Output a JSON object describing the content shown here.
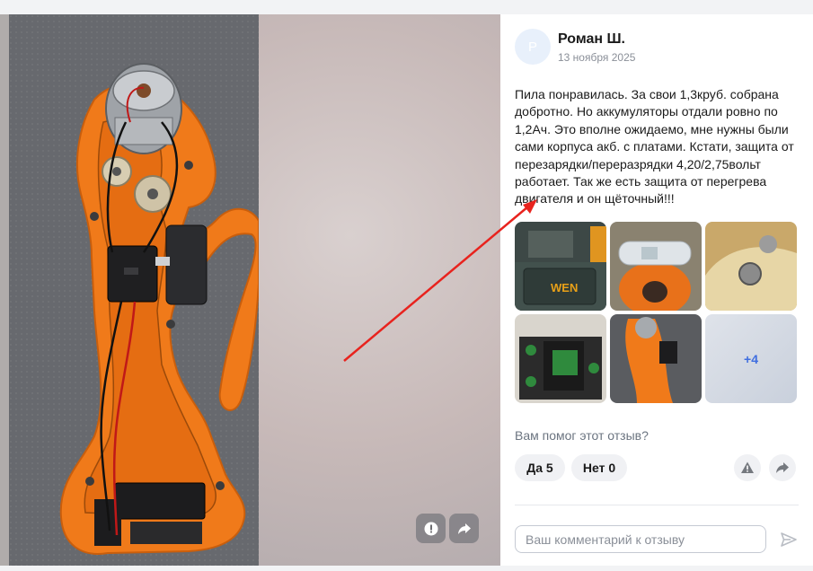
{
  "review": {
    "author_initial": "Р",
    "author": "Роман Ш.",
    "date": "13 ноября 2025",
    "text": "Пила понравилась. За свои 1,3круб. собрана добротно. Но аккумуляторы отдали ровно по 1,2Ач. Это вполне ожидаемо, мне нужны были сами корпуса акб. с платами. Кстати, защита от перезарядки/переразрядки 4,20/2,75вольт работает. Так же есть защита от перегрева двигателя и он щёточный!!!",
    "more_photos_label": "+4"
  },
  "feedback": {
    "question": "Вам помог этот отзыв?",
    "yes_label": "Да 5",
    "no_label": "Нет 0"
  },
  "comment": {
    "placeholder": "Ваш комментарий к отзыву"
  },
  "icons": {
    "report": "warning-triangle-icon",
    "share": "share-arrow-icon",
    "send": "send-paper-plane-icon",
    "annotation": "red-arrow"
  },
  "colors": {
    "accent": "#3f6ee0",
    "tool_orange": "#f07a1a",
    "annotation_red": "#e8231e"
  }
}
